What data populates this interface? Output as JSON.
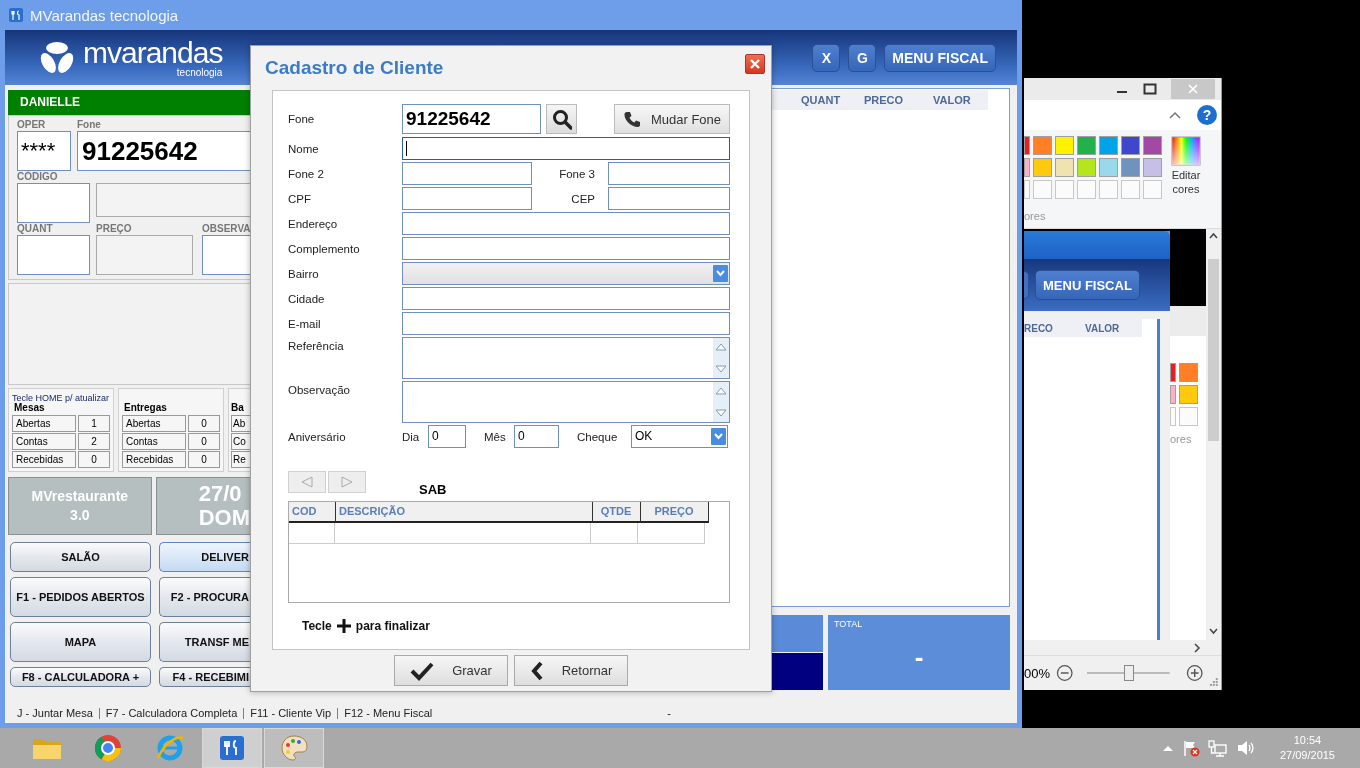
{
  "main_window": {
    "title": "MVarandas tecnologia",
    "logo": {
      "name": "mvarandas",
      "sub": "tecnologia"
    },
    "header_buttons": [
      "X",
      "G",
      "MENU FISCAL"
    ],
    "operator": "DANIELLE",
    "fields": {
      "oper_label": "OPER",
      "oper": "****",
      "fone_label": "Fone",
      "fone": "91225642",
      "codigo_label": "CÓDIGO",
      "quant_label": "QUANT",
      "preco_label": "PREÇO",
      "obs_label": "OBSERVA"
    },
    "refresh_hint": "Tecle HOME p/ atualizar",
    "stats": [
      {
        "title": "Mesas",
        "rows": [
          {
            "label": "Abertas",
            "value": "1"
          },
          {
            "label": "Contas",
            "value": "2"
          },
          {
            "label": "Recebidas",
            "value": "0"
          }
        ]
      },
      {
        "title": "Entregas",
        "rows": [
          {
            "label": "Abertas",
            "value": "0"
          },
          {
            "label": "Contas",
            "value": "0"
          },
          {
            "label": "Recebidas",
            "value": "0"
          }
        ]
      },
      {
        "title": "Ba",
        "rows": [
          {
            "label": "Ab"
          },
          {
            "label": "Co"
          },
          {
            "label": "Re"
          }
        ]
      }
    ],
    "info_tiles": [
      {
        "kind": "version",
        "lines": [
          "MVrestaurante",
          "3.0"
        ]
      },
      {
        "kind": "date",
        "lines": [
          "27/0",
          "DOM"
        ]
      }
    ],
    "buttons": [
      {
        "label": "SALÃO",
        "selected": false
      },
      {
        "label": "DELIVER",
        "selected": true
      },
      {
        "label": "F1 - PEDIDOS ABERTOS",
        "selected": false
      },
      {
        "label": "F2 - PROCURA",
        "selected": false
      },
      {
        "label": "MAPA",
        "selected": false
      },
      {
        "label": "TRANSF ME",
        "selected": false
      },
      {
        "label": "F8 - CALCULADORA +",
        "selected": false
      },
      {
        "label": "F4 - RECEBIMI",
        "selected": false
      }
    ],
    "items_columns": [
      "QUANT",
      "PRECO",
      "VALOR"
    ],
    "total": {
      "label": "TOTAL",
      "value": "-"
    },
    "shortcuts": [
      "J - Juntar Mesa",
      "F7 - Calculadora Completa",
      "F11 - Cliente Vip",
      "F12 - Menu Fiscal"
    ],
    "status_mark": "-"
  },
  "dialog": {
    "title": "Cadastro de Cliente",
    "fone": {
      "label": "Fone",
      "value": "91225642"
    },
    "change_phone": "Mudar Fone",
    "rows": [
      {
        "kind": "text",
        "label": "Nome",
        "focused": true
      },
      {
        "kind": "pair",
        "label": "Fone 2",
        "label2": "Fone 3"
      },
      {
        "kind": "pair",
        "label": "CPF",
        "label2": "CEP"
      },
      {
        "kind": "text",
        "label": "Endereço",
        "focused": false
      },
      {
        "kind": "text",
        "label": "Complemento",
        "focused": false
      },
      {
        "kind": "combo",
        "label": "Bairro",
        "disabled": true
      },
      {
        "kind": "text",
        "label": "Cidade",
        "focused": false
      },
      {
        "kind": "text",
        "label": "E-mail",
        "focused": false
      },
      {
        "kind": "memo",
        "label": "Referência"
      },
      {
        "kind": "memo",
        "label": "Observação"
      }
    ],
    "birthday": {
      "label": "Aniversário",
      "day_label": "Dia",
      "day": "0",
      "month_label": "Mês",
      "month": "0",
      "check_label": "Cheque",
      "check": "OK"
    },
    "pager": [
      {
        "kind": "prev",
        "disabled": true
      },
      {
        "kind": "next",
        "disabled": true
      }
    ],
    "group_label": "SAB",
    "grid_columns": [
      "COD",
      "DESCRIÇÃO",
      "QTDE",
      "PREÇO"
    ],
    "hint": {
      "before": "Tecle",
      "after": "para finalizar"
    },
    "buttons": [
      {
        "kind": "save",
        "label": "Gravar"
      },
      {
        "kind": "back",
        "label": "Retornar"
      }
    ]
  },
  "paint_window": {
    "help": "?",
    "palette": [
      {
        "color": "#ed1c24"
      },
      {
        "color": "#ff7f27"
      },
      {
        "color": "#fff200"
      },
      {
        "color": "#22b14c"
      },
      {
        "color": "#00a2e8"
      },
      {
        "color": "#3f48cc"
      },
      {
        "color": "#a349a4"
      },
      {
        "color": "#ffaec9"
      },
      {
        "color": "#ffc90e"
      },
      {
        "color": "#efe4b0"
      },
      {
        "color": "#b5e61d"
      },
      {
        "color": "#99d9ea"
      },
      {
        "color": "#7092be"
      },
      {
        "color": "#c8bfe7"
      },
      {
        "kind": "empty"
      },
      {
        "kind": "empty"
      },
      {
        "kind": "empty"
      },
      {
        "kind": "empty"
      },
      {
        "kind": "empty"
      },
      {
        "kind": "empty"
      },
      {
        "kind": "empty"
      }
    ],
    "edit_colors": "Editar cores",
    "colors_group": "ores",
    "nested": {
      "header_button": "MENU FISCAL",
      "columns": [
        "RECO",
        "VALOR"
      ],
      "palette": [
        {
          "color": "#ed1c24"
        },
        {
          "color": "#ff7f27"
        },
        {
          "color": "#ffaec9"
        },
        {
          "color": "#ffc90e"
        },
        {
          "kind": "empty"
        },
        {
          "kind": "empty"
        }
      ],
      "colors_group": "ores"
    },
    "zoom_text": "00%",
    "zoom_slider": {
      "level": 0.5
    }
  },
  "taskbar": {
    "apps": [
      {
        "kind": "folder",
        "running": false,
        "selected": false
      },
      {
        "kind": "browser",
        "running": false,
        "selected": false
      },
      {
        "kind": "web",
        "running": false,
        "selected": false
      },
      {
        "kind": "restaurant",
        "running": true,
        "selected": true
      },
      {
        "kind": "paint",
        "running": true,
        "selected": false
      }
    ],
    "time": "10:54",
    "date": "27/09/2015"
  }
}
